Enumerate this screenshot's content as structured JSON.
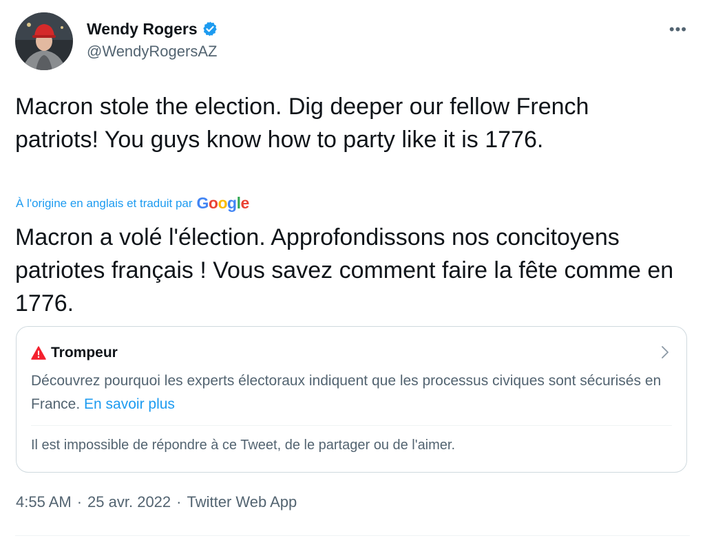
{
  "author": {
    "display_name": "Wendy Rogers",
    "handle": "@WendyRogersAZ",
    "verified": true
  },
  "more_menu": "•••",
  "tweet": {
    "original_text": "Macron stole the election. Dig deeper our fellow French patriots! You guys know how to party like it is 1776.",
    "translation_notice": "À l'origine en anglais et traduit par",
    "translation_provider": "Google",
    "translated_text": "Macron a volé l'élection. Approfondissons nos concitoyens patriotes français ! Vous savez comment faire la fête comme en 1776."
  },
  "notice": {
    "title": "Trompeur",
    "body": "Découvrez pourquoi les experts électoraux indiquent que les processus civiques sont sécurisés en France. ",
    "link": "En savoir plus",
    "footer": "Il est impossible de répondre à ce Tweet, de le partager ou de l'aimer."
  },
  "meta": {
    "time": "4:55 AM",
    "sep1": "·",
    "date": "25 avr. 2022",
    "sep2": "·",
    "source": "Twitter Web App"
  },
  "colors": {
    "accent": "#1d9bf0",
    "secondary_text": "#536471",
    "primary_text": "#0f1419",
    "warning": "#f4212e",
    "border": "#cfd9de"
  },
  "icons": {
    "verified": "verified-badge-icon",
    "warning": "warning-triangle-icon",
    "chevron": "chevron-right-icon",
    "more": "more-dots-icon"
  }
}
